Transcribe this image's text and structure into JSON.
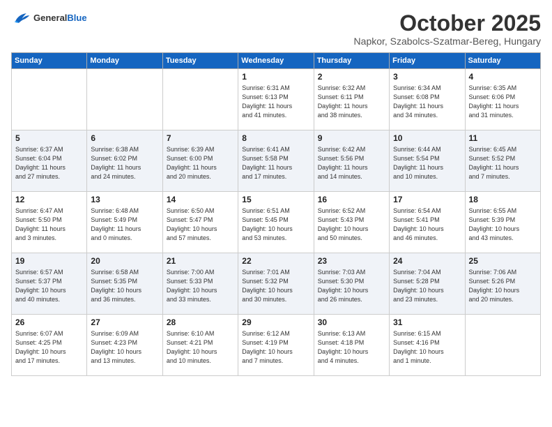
{
  "header": {
    "logo_general": "General",
    "logo_blue": "Blue",
    "month": "October 2025",
    "location": "Napkor, Szabolcs-Szatmar-Bereg, Hungary"
  },
  "weekdays": [
    "Sunday",
    "Monday",
    "Tuesday",
    "Wednesday",
    "Thursday",
    "Friday",
    "Saturday"
  ],
  "weeks": [
    [
      {
        "day": "",
        "info": ""
      },
      {
        "day": "",
        "info": ""
      },
      {
        "day": "",
        "info": ""
      },
      {
        "day": "1",
        "info": "Sunrise: 6:31 AM\nSunset: 6:13 PM\nDaylight: 11 hours\nand 41 minutes."
      },
      {
        "day": "2",
        "info": "Sunrise: 6:32 AM\nSunset: 6:11 PM\nDaylight: 11 hours\nand 38 minutes."
      },
      {
        "day": "3",
        "info": "Sunrise: 6:34 AM\nSunset: 6:08 PM\nDaylight: 11 hours\nand 34 minutes."
      },
      {
        "day": "4",
        "info": "Sunrise: 6:35 AM\nSunset: 6:06 PM\nDaylight: 11 hours\nand 31 minutes."
      }
    ],
    [
      {
        "day": "5",
        "info": "Sunrise: 6:37 AM\nSunset: 6:04 PM\nDaylight: 11 hours\nand 27 minutes."
      },
      {
        "day": "6",
        "info": "Sunrise: 6:38 AM\nSunset: 6:02 PM\nDaylight: 11 hours\nand 24 minutes."
      },
      {
        "day": "7",
        "info": "Sunrise: 6:39 AM\nSunset: 6:00 PM\nDaylight: 11 hours\nand 20 minutes."
      },
      {
        "day": "8",
        "info": "Sunrise: 6:41 AM\nSunset: 5:58 PM\nDaylight: 11 hours\nand 17 minutes."
      },
      {
        "day": "9",
        "info": "Sunrise: 6:42 AM\nSunset: 5:56 PM\nDaylight: 11 hours\nand 14 minutes."
      },
      {
        "day": "10",
        "info": "Sunrise: 6:44 AM\nSunset: 5:54 PM\nDaylight: 11 hours\nand 10 minutes."
      },
      {
        "day": "11",
        "info": "Sunrise: 6:45 AM\nSunset: 5:52 PM\nDaylight: 11 hours\nand 7 minutes."
      }
    ],
    [
      {
        "day": "12",
        "info": "Sunrise: 6:47 AM\nSunset: 5:50 PM\nDaylight: 11 hours\nand 3 minutes."
      },
      {
        "day": "13",
        "info": "Sunrise: 6:48 AM\nSunset: 5:49 PM\nDaylight: 11 hours\nand 0 minutes."
      },
      {
        "day": "14",
        "info": "Sunrise: 6:50 AM\nSunset: 5:47 PM\nDaylight: 10 hours\nand 57 minutes."
      },
      {
        "day": "15",
        "info": "Sunrise: 6:51 AM\nSunset: 5:45 PM\nDaylight: 10 hours\nand 53 minutes."
      },
      {
        "day": "16",
        "info": "Sunrise: 6:52 AM\nSunset: 5:43 PM\nDaylight: 10 hours\nand 50 minutes."
      },
      {
        "day": "17",
        "info": "Sunrise: 6:54 AM\nSunset: 5:41 PM\nDaylight: 10 hours\nand 46 minutes."
      },
      {
        "day": "18",
        "info": "Sunrise: 6:55 AM\nSunset: 5:39 PM\nDaylight: 10 hours\nand 43 minutes."
      }
    ],
    [
      {
        "day": "19",
        "info": "Sunrise: 6:57 AM\nSunset: 5:37 PM\nDaylight: 10 hours\nand 40 minutes."
      },
      {
        "day": "20",
        "info": "Sunrise: 6:58 AM\nSunset: 5:35 PM\nDaylight: 10 hours\nand 36 minutes."
      },
      {
        "day": "21",
        "info": "Sunrise: 7:00 AM\nSunset: 5:33 PM\nDaylight: 10 hours\nand 33 minutes."
      },
      {
        "day": "22",
        "info": "Sunrise: 7:01 AM\nSunset: 5:32 PM\nDaylight: 10 hours\nand 30 minutes."
      },
      {
        "day": "23",
        "info": "Sunrise: 7:03 AM\nSunset: 5:30 PM\nDaylight: 10 hours\nand 26 minutes."
      },
      {
        "day": "24",
        "info": "Sunrise: 7:04 AM\nSunset: 5:28 PM\nDaylight: 10 hours\nand 23 minutes."
      },
      {
        "day": "25",
        "info": "Sunrise: 7:06 AM\nSunset: 5:26 PM\nDaylight: 10 hours\nand 20 minutes."
      }
    ],
    [
      {
        "day": "26",
        "info": "Sunrise: 6:07 AM\nSunset: 4:25 PM\nDaylight: 10 hours\nand 17 minutes."
      },
      {
        "day": "27",
        "info": "Sunrise: 6:09 AM\nSunset: 4:23 PM\nDaylight: 10 hours\nand 13 minutes."
      },
      {
        "day": "28",
        "info": "Sunrise: 6:10 AM\nSunset: 4:21 PM\nDaylight: 10 hours\nand 10 minutes."
      },
      {
        "day": "29",
        "info": "Sunrise: 6:12 AM\nSunset: 4:19 PM\nDaylight: 10 hours\nand 7 minutes."
      },
      {
        "day": "30",
        "info": "Sunrise: 6:13 AM\nSunset: 4:18 PM\nDaylight: 10 hours\nand 4 minutes."
      },
      {
        "day": "31",
        "info": "Sunrise: 6:15 AM\nSunset: 4:16 PM\nDaylight: 10 hours\nand 1 minute."
      },
      {
        "day": "",
        "info": ""
      }
    ]
  ]
}
